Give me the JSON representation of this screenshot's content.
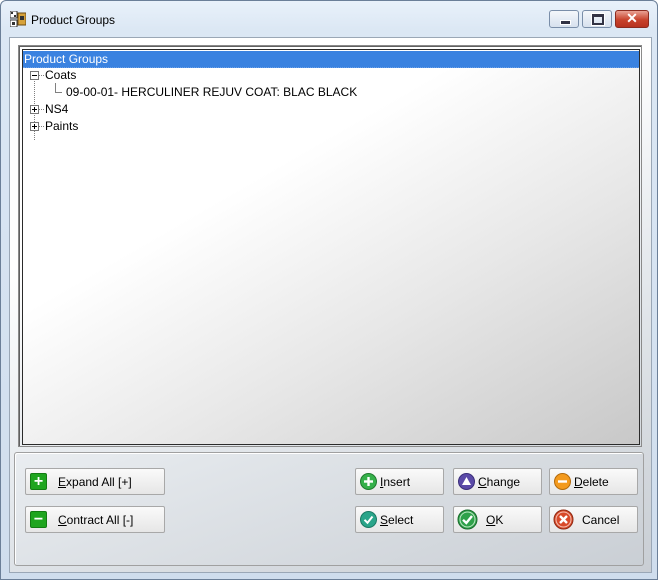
{
  "window": {
    "title": "Product Groups"
  },
  "tree": {
    "root": "Product Groups",
    "items": [
      {
        "label": "Coats",
        "expanded": true,
        "children": [
          "09-00-01- HERCULINER REJUV COAT: BLAC BLACK"
        ]
      },
      {
        "label": "NS4",
        "expanded": false
      },
      {
        "label": "Paints",
        "expanded": false
      }
    ]
  },
  "buttons": {
    "expand_all": {
      "mnemonic": "E",
      "rest": "xpand All [+]"
    },
    "contract_all": {
      "mnemonic": "C",
      "rest": "ontract All [-]"
    },
    "insert": {
      "mnemonic": "I",
      "rest": "nsert"
    },
    "change": {
      "mnemonic": "C",
      "rest": "hange"
    },
    "delete": {
      "mnemonic": "D",
      "rest": "elete"
    },
    "select": {
      "mnemonic": "S",
      "rest": "elect"
    },
    "ok": {
      "mnemonic": "O",
      "rest": "K"
    },
    "cancel": "Cancel"
  },
  "colors": {
    "selection": "#3a82e0",
    "green": "#1fa51f",
    "violet": "#5b4aa8",
    "orange": "#f39a1e",
    "red": "#d84a2a",
    "teal": "#2aa58a"
  }
}
